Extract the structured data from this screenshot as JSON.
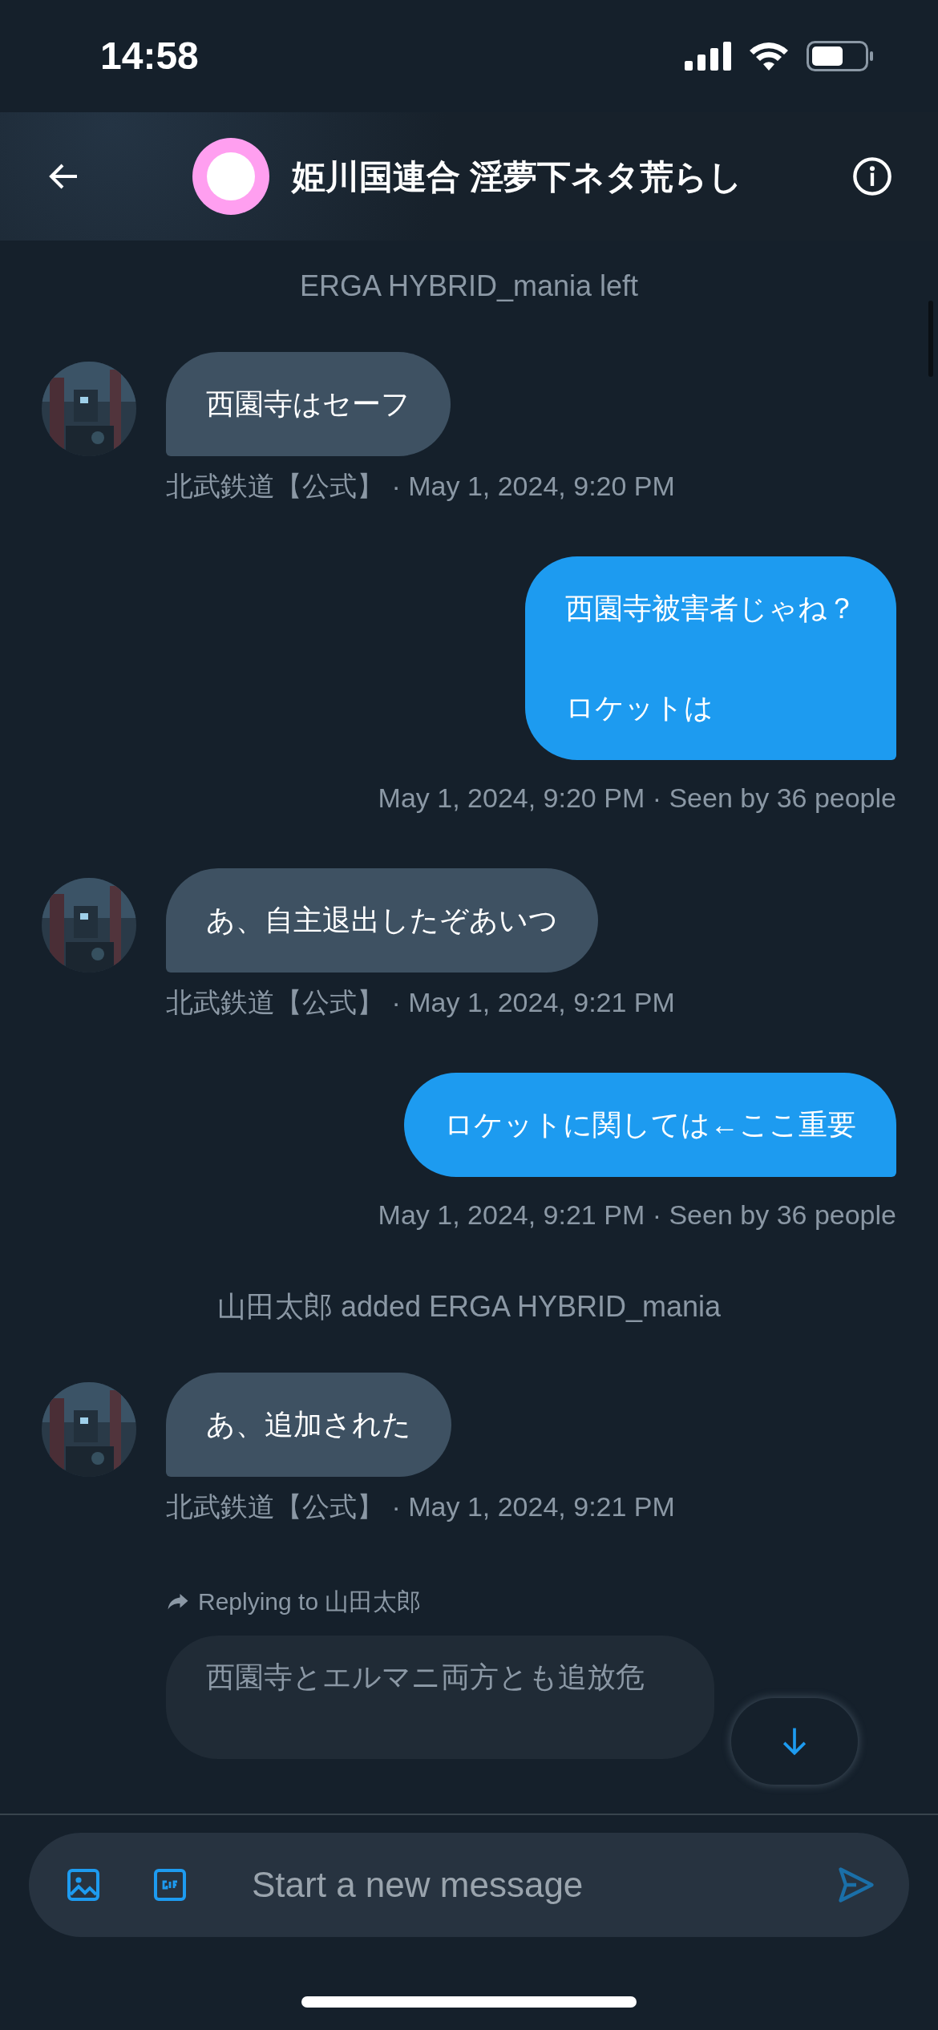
{
  "status_bar": {
    "time": "14:58"
  },
  "header": {
    "title": "姫川国連合 淫夢下ネタ荒らし"
  },
  "messages": [
    {
      "kind": "system",
      "text": "ERGA HYBRID_mania left"
    },
    {
      "kind": "received",
      "text": "西園寺はセーフ",
      "meta": "北武鉄道【公式】 · May 1, 2024, 9:20 PM"
    },
    {
      "kind": "sent",
      "lines": [
        "西園寺被害者じゃね？",
        "ロケットは"
      ],
      "meta": "May 1, 2024, 9:20 PM · Seen by 36 people"
    },
    {
      "kind": "received",
      "text": "あ、自主退出したぞあいつ",
      "meta": "北武鉄道【公式】 · May 1, 2024, 9:21 PM"
    },
    {
      "kind": "sent",
      "lines": [
        "ロケットに関しては←ここ重要"
      ],
      "meta": "May 1, 2024, 9:21 PM · Seen by 36 people"
    },
    {
      "kind": "system",
      "text": "山田太郎 added ERGA HYBRID_mania"
    },
    {
      "kind": "received",
      "text": "あ、追加された",
      "meta": "北武鉄道【公式】 · May 1, 2024, 9:21 PM"
    },
    {
      "kind": "reply",
      "replying_to": "Replying to 山田太郎",
      "text": "西園寺とエルマニ両方とも追放危"
    }
  ],
  "composer": {
    "placeholder": "Start a new message"
  }
}
